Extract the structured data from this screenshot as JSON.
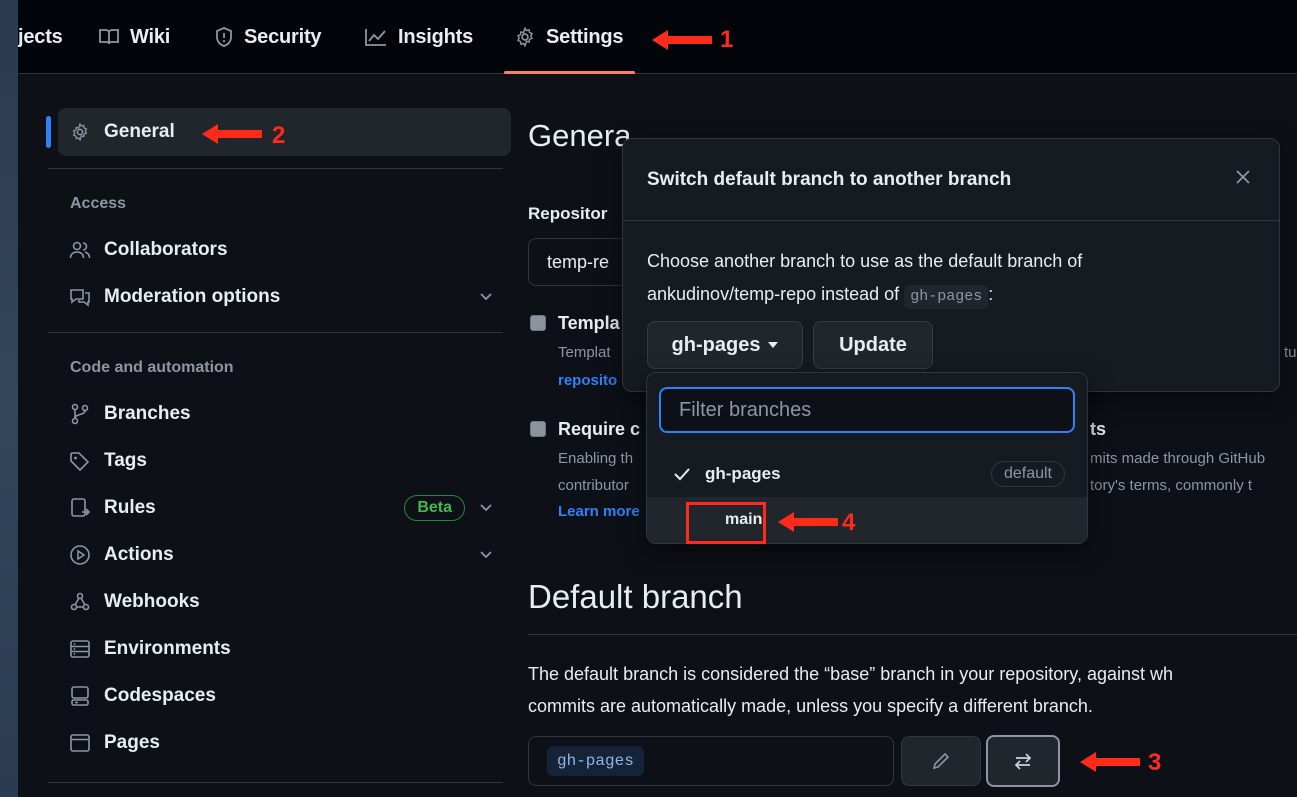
{
  "nav": {
    "tabs": [
      {
        "label": "jects",
        "icon": "project-icon"
      },
      {
        "label": "Wiki",
        "icon": "book-icon"
      },
      {
        "label": "Security",
        "icon": "shield-icon"
      },
      {
        "label": "Insights",
        "icon": "graph-icon"
      },
      {
        "label": "Settings",
        "icon": "gear-icon"
      }
    ]
  },
  "annotations": [
    "1",
    "2",
    "3",
    "4"
  ],
  "sidebar": {
    "general": "General",
    "sections": {
      "access": "Access",
      "code": "Code and automation"
    },
    "items": [
      {
        "label": "Collaborators",
        "icon": "people-icon"
      },
      {
        "label": "Moderation options",
        "icon": "comment-icon"
      },
      {
        "label": "Branches",
        "icon": "git-branch-icon"
      },
      {
        "label": "Tags",
        "icon": "tag-icon"
      },
      {
        "label": "Rules",
        "icon": "rules-icon",
        "badge": "Beta"
      },
      {
        "label": "Actions",
        "icon": "play-icon"
      },
      {
        "label": "Webhooks",
        "icon": "webhook-icon"
      },
      {
        "label": "Environments",
        "icon": "server-icon"
      },
      {
        "label": "Codespaces",
        "icon": "codespaces-icon"
      },
      {
        "label": "Pages",
        "icon": "browser-icon"
      }
    ]
  },
  "main": {
    "title": "Genera",
    "repo_label": "Repositor",
    "repo_value": "temp-re",
    "template": {
      "title": "Templa",
      "desc": "Templat",
      "link": "reposito",
      "right": "tu"
    },
    "require": {
      "title": "Require c",
      "title_right": "ts",
      "line1": "Enabling th",
      "line1_right": "mits made through GitHub",
      "line2": "contributor",
      "line2_right": "tory's terms, commonly t",
      "link": "Learn more"
    },
    "default_branch": {
      "title": "Default branch",
      "para1": "The default branch is considered the “base” branch in your repository, against wh",
      "para2": "commits are automatically made, unless you specify a different branch.",
      "current": "gh-pages"
    }
  },
  "dialog": {
    "title": "Switch default branch to another branch",
    "body_line1": "Choose another branch to use as the default branch of",
    "body_line2": "ankudinov/temp-repo instead of",
    "current_branch": "gh-pages",
    "colon": ":",
    "branch_button": "gh-pages",
    "update_button": "Update"
  },
  "dropdown": {
    "placeholder": "Filter branches",
    "items": [
      {
        "label": "gh-pages",
        "badge": "default",
        "selected": true
      },
      {
        "label": "main",
        "selected": false
      }
    ]
  },
  "colors": {
    "accent": "#2f81f7",
    "underline": "#f78166",
    "annotation": "#ff2a1a",
    "beta": "#3fb950"
  }
}
